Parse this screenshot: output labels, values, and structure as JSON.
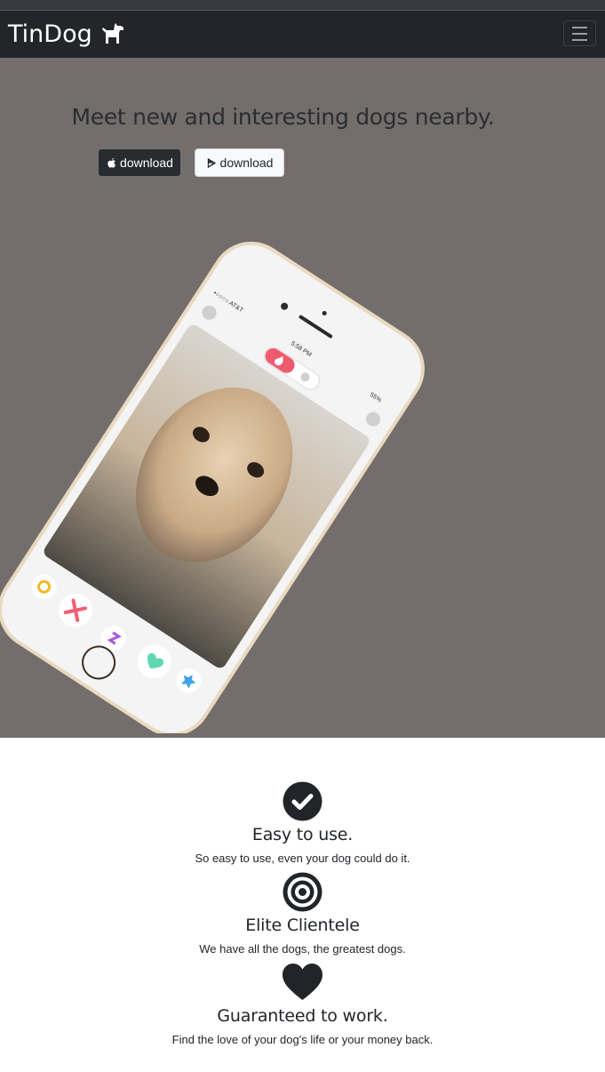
{
  "navbar": {
    "brand": "TinDog",
    "brand_icon": "dog-icon",
    "menu_icon": "hamburger-menu-icon"
  },
  "hero": {
    "title": "Meet new and interesting dogs nearby.",
    "background": "#736e6b",
    "buttons": [
      {
        "label": "download",
        "icon": "apple-icon",
        "style": "dark"
      },
      {
        "label": "download",
        "icon": "play-store-icon",
        "style": "light"
      }
    ],
    "phone": {
      "carrier": "•○○○○ AT&T",
      "time": "5:58 PM",
      "battery": "55%"
    }
  },
  "features": [
    {
      "icon": "check-circle-icon",
      "title": "Easy to use.",
      "text": "So easy to use, even your dog could do it."
    },
    {
      "icon": "bullseye-icon",
      "title": "Elite Clientele",
      "text": "We have all the dogs, the greatest dogs."
    },
    {
      "icon": "heart-icon",
      "title": "Guaranteed to work.",
      "text": "Find the love of your dog's life or your money back."
    }
  ]
}
